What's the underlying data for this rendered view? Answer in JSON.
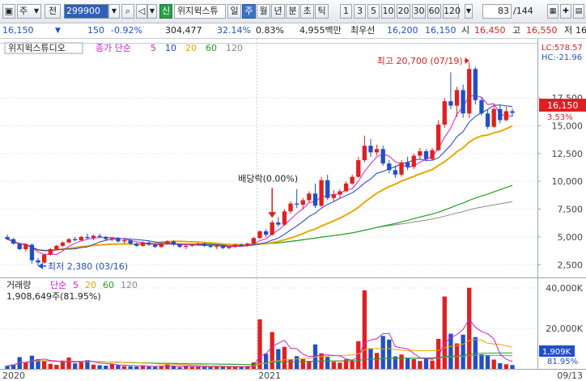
{
  "toolbar": {
    "main_label": "주",
    "prefix_label": "전",
    "code": "299900",
    "name": "위지윅스튜",
    "shin_label": "신",
    "periods": [
      "일",
      "주",
      "월",
      "년",
      "분",
      "초",
      "틱"
    ],
    "active_period": "주",
    "numbers": [
      "1",
      "3",
      "5",
      "10",
      "20",
      "30",
      "60",
      "120"
    ],
    "counter": "83",
    "counter_total": "/144"
  },
  "quote": {
    "price": "16,150",
    "change": "150",
    "change_pct": "-0.92%",
    "volume": "304,477",
    "pct1": "32.14%",
    "pct2": "0.83%",
    "amount": "4,955백만",
    "best_label": "최우선",
    "best_sell": "16,200",
    "best_buy": "16,150",
    "open_label": "시",
    "open": "16,450",
    "high_label": "고",
    "high": "16,550",
    "low_label": "저",
    "low": "16"
  },
  "price_panel": {
    "stock_name": "위지윅스튜디오",
    "ma_title": "종가 단순",
    "ma_labels": [
      "5",
      "10",
      "20",
      "60",
      "120"
    ],
    "lc": "LC:578.57",
    "hc": "HC:-21.96",
    "current_price": "16,150",
    "current_pct": "3.53%",
    "high_annotation": "최고 20,700 (07/19)",
    "low_annotation": "최저 2,380 (03/16)",
    "dividend_annotation": "배당락(0.00%)",
    "y_ticks": [
      "17,500",
      "15,000",
      "12,500",
      "10,000",
      "7,500",
      "5,000",
      "2,500"
    ]
  },
  "volume_panel": {
    "title": "거래량",
    "ma_title": "단순",
    "ma_labels": [
      "5",
      "20",
      "60",
      "120"
    ],
    "current_volume": "1,908,649주(81.95%)",
    "y_ticks": [
      "40,000K",
      "20,000K"
    ],
    "current_label": "1,909K",
    "current_pct": "81.95%"
  },
  "x_axis": {
    "labels": [
      "2020",
      "2021"
    ],
    "end_label": "09/13"
  },
  "chart_data": {
    "type": "candlestick",
    "up_color": "#e02020",
    "down_color": "#2050c8",
    "ylim": [
      1500,
      21500
    ],
    "vol_max": 44000,
    "ma_colors": {
      "5": "#d020d0",
      "10": "#2040c8",
      "20": "#e6a800",
      "60": "#20a020",
      "120": "#888888"
    },
    "candles": [
      [
        5000,
        5200,
        4700,
        4800
      ],
      [
        4800,
        4900,
        4300,
        4400
      ],
      [
        4400,
        4500,
        3800,
        3900
      ],
      [
        3900,
        4400,
        3700,
        4300
      ],
      [
        4300,
        4400,
        2600,
        2900
      ],
      [
        2900,
        3100,
        2380,
        2700
      ],
      [
        2700,
        3500,
        2600,
        3400
      ],
      [
        3400,
        4000,
        3300,
        3900
      ],
      [
        3900,
        4300,
        3800,
        4200
      ],
      [
        4200,
        4600,
        4100,
        4500
      ],
      [
        4500,
        4900,
        4400,
        4800
      ],
      [
        4800,
        5000,
        4600,
        4700
      ],
      [
        4700,
        5100,
        4600,
        5000
      ],
      [
        5000,
        5300,
        4800,
        4900
      ],
      [
        4900,
        5200,
        4700,
        5100
      ],
      [
        5100,
        5300,
        4900,
        5000
      ],
      [
        5000,
        5100,
        4700,
        4800
      ],
      [
        4800,
        5000,
        4600,
        4900
      ],
      [
        4900,
        5000,
        4500,
        4600
      ],
      [
        4600,
        4800,
        4400,
        4700
      ],
      [
        4700,
        4800,
        4300,
        4400
      ],
      [
        4400,
        4500,
        4100,
        4200
      ],
      [
        4200,
        4600,
        4100,
        4500
      ],
      [
        4500,
        4600,
        4200,
        4300
      ],
      [
        4300,
        4400,
        4000,
        4100
      ],
      [
        4100,
        4500,
        4000,
        4400
      ],
      [
        4400,
        4700,
        4300,
        4600
      ],
      [
        4600,
        4700,
        4200,
        4300
      ],
      [
        4300,
        4400,
        4000,
        4100
      ],
      [
        4100,
        4300,
        3900,
        4200
      ],
      [
        4200,
        4400,
        4100,
        4300
      ],
      [
        4300,
        4500,
        4200,
        4400
      ],
      [
        4400,
        4500,
        4100,
        4200
      ],
      [
        4200,
        4300,
        4000,
        4100
      ],
      [
        4100,
        4300,
        3900,
        4200
      ],
      [
        4200,
        4300,
        3900,
        4000
      ],
      [
        4000,
        4200,
        3900,
        4100
      ],
      [
        4100,
        4400,
        4000,
        4300
      ],
      [
        4300,
        4400,
        4100,
        4200
      ],
      [
        4200,
        4500,
        4100,
        4400
      ],
      [
        4400,
        5000,
        4300,
        4900
      ],
      [
        4900,
        5600,
        4800,
        5500
      ],
      [
        5500,
        5700,
        5000,
        5200
      ],
      [
        5200,
        6500,
        5100,
        6300
      ],
      [
        6300,
        6800,
        5900,
        6100
      ],
      [
        6100,
        7500,
        6000,
        7300
      ],
      [
        7300,
        8200,
        7100,
        8000
      ],
      [
        8000,
        9300,
        7600,
        7900
      ],
      [
        7900,
        8500,
        7500,
        8300
      ],
      [
        8300,
        9100,
        8100,
        8900
      ],
      [
        8900,
        9800,
        7600,
        7800
      ],
      [
        7800,
        10400,
        7700,
        10100
      ],
      [
        10100,
        10600,
        8300,
        8500
      ],
      [
        8500,
        9200,
        8200,
        8800
      ],
      [
        8800,
        9300,
        8400,
        9100
      ],
      [
        9100,
        10000,
        9000,
        9800
      ],
      [
        9800,
        10600,
        9700,
        10400
      ],
      [
        10400,
        12200,
        10300,
        11900
      ],
      [
        11900,
        14100,
        11700,
        13200
      ],
      [
        13200,
        13800,
        12200,
        12600
      ],
      [
        12600,
        13300,
        12300,
        12900
      ],
      [
        12900,
        13200,
        11400,
        11600
      ],
      [
        11600,
        11900,
        10700,
        11000
      ],
      [
        11000,
        11400,
        10300,
        10600
      ],
      [
        10600,
        11900,
        10400,
        11700
      ],
      [
        11700,
        12200,
        11000,
        11300
      ],
      [
        11300,
        12500,
        11100,
        12300
      ],
      [
        12300,
        13000,
        12000,
        12700
      ],
      [
        12700,
        12900,
        11800,
        12000
      ],
      [
        12000,
        13000,
        11900,
        12800
      ],
      [
        12800,
        15500,
        12700,
        15100
      ],
      [
        15100,
        17500,
        14800,
        17200
      ],
      [
        17200,
        19800,
        16500,
        16800
      ],
      [
        16800,
        18500,
        15800,
        18200
      ],
      [
        18200,
        18700,
        15700,
        16100
      ],
      [
        16100,
        20700,
        15700,
        20100
      ],
      [
        20100,
        20300,
        16900,
        17300
      ],
      [
        17300,
        17600,
        15900,
        16100
      ],
      [
        16100,
        16500,
        14700,
        14900
      ],
      [
        14900,
        16900,
        14800,
        16500
      ],
      [
        16500,
        16900,
        15200,
        15500
      ],
      [
        15500,
        16700,
        15400,
        16300
      ],
      [
        16300,
        16550,
        15800,
        16150
      ]
    ],
    "volumes": [
      [
        1500,
        0
      ],
      [
        2200,
        0
      ],
      [
        5800,
        0
      ],
      [
        3100,
        1
      ],
      [
        6500,
        0
      ],
      [
        4800,
        0
      ],
      [
        3900,
        1
      ],
      [
        2500,
        1
      ],
      [
        2000,
        1
      ],
      [
        4100,
        1
      ],
      [
        5600,
        1
      ],
      [
        2700,
        0
      ],
      [
        3300,
        1
      ],
      [
        4300,
        0
      ],
      [
        2100,
        1
      ],
      [
        1800,
        0
      ],
      [
        1600,
        0
      ],
      [
        2400,
        1
      ],
      [
        1900,
        0
      ],
      [
        1400,
        1
      ],
      [
        1300,
        0
      ],
      [
        1200,
        0
      ],
      [
        1700,
        1
      ],
      [
        1100,
        0
      ],
      [
        1000,
        0
      ],
      [
        1500,
        1
      ],
      [
        2100,
        1
      ],
      [
        1300,
        0
      ],
      [
        900,
        0
      ],
      [
        1200,
        1
      ],
      [
        1000,
        1
      ],
      [
        1400,
        1
      ],
      [
        1100,
        0
      ],
      [
        900,
        0
      ],
      [
        1200,
        1
      ],
      [
        1000,
        0
      ],
      [
        800,
        1
      ],
      [
        1100,
        1
      ],
      [
        900,
        0
      ],
      [
        1500,
        1
      ],
      [
        3200,
        1
      ],
      [
        24500,
        1
      ],
      [
        7500,
        0
      ],
      [
        18200,
        1
      ],
      [
        9800,
        0
      ],
      [
        10900,
        1
      ],
      [
        4600,
        1
      ],
      [
        6300,
        0
      ],
      [
        4800,
        1
      ],
      [
        3900,
        1
      ],
      [
        12100,
        0
      ],
      [
        7700,
        1
      ],
      [
        5900,
        0
      ],
      [
        3500,
        1
      ],
      [
        3100,
        1
      ],
      [
        4700,
        1
      ],
      [
        4200,
        1
      ],
      [
        13700,
        1
      ],
      [
        38800,
        1
      ],
      [
        10200,
        0
      ],
      [
        7900,
        1
      ],
      [
        16300,
        0
      ],
      [
        14500,
        0
      ],
      [
        6200,
        0
      ],
      [
        7100,
        1
      ],
      [
        5500,
        0
      ],
      [
        4800,
        1
      ],
      [
        3900,
        1
      ],
      [
        5000,
        0
      ],
      [
        4100,
        1
      ],
      [
        14800,
        1
      ],
      [
        35800,
        1
      ],
      [
        17400,
        0
      ],
      [
        12600,
        1
      ],
      [
        16900,
        0
      ],
      [
        40100,
        1
      ],
      [
        15700,
        0
      ],
      [
        7200,
        0
      ],
      [
        6700,
        0
      ],
      [
        4600,
        1
      ],
      [
        2800,
        0
      ],
      [
        2300,
        1
      ],
      [
        1900,
        0
      ]
    ]
  }
}
